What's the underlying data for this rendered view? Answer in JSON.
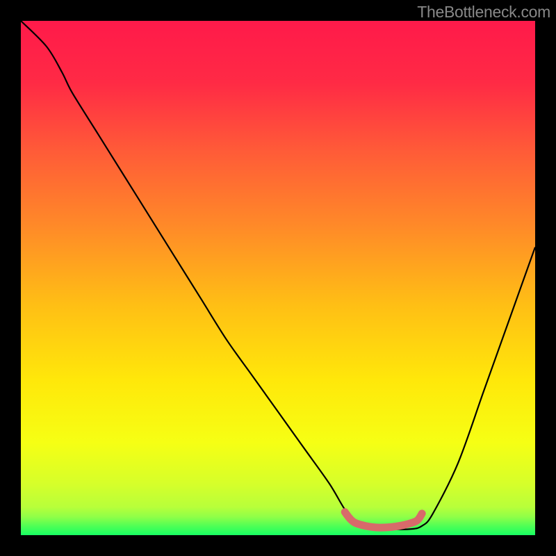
{
  "watermark": "TheBottleneck.com",
  "chart_data": {
    "type": "line",
    "title": "",
    "xlabel": "",
    "ylabel": "",
    "xlim": [
      0,
      100
    ],
    "ylim": [
      0,
      100
    ],
    "series": [
      {
        "name": "curve",
        "x": [
          0,
          5,
          8,
          10,
          15,
          20,
          25,
          30,
          35,
          40,
          45,
          50,
          55,
          60,
          63,
          65,
          68,
          72,
          76,
          78,
          80,
          85,
          90,
          95,
          100
        ],
        "values": [
          100,
          95,
          90,
          86,
          78,
          70,
          62,
          54,
          46,
          38,
          31,
          24,
          17,
          10,
          5,
          3,
          1.8,
          1.2,
          1.2,
          1.8,
          4,
          14,
          28,
          42,
          56
        ]
      },
      {
        "name": "minimum-marker",
        "x": [
          63,
          64,
          65,
          67,
          69,
          71,
          73,
          75,
          77,
          78
        ],
        "values": [
          4.5,
          3.2,
          2.4,
          1.8,
          1.5,
          1.5,
          1.7,
          2.1,
          2.8,
          4.2
        ]
      }
    ],
    "gradient_stops": [
      {
        "offset": 0.0,
        "color": "#ff1a4a"
      },
      {
        "offset": 0.12,
        "color": "#ff2a45"
      },
      {
        "offset": 0.25,
        "color": "#ff5a38"
      },
      {
        "offset": 0.4,
        "color": "#ff8a28"
      },
      {
        "offset": 0.55,
        "color": "#ffbe15"
      },
      {
        "offset": 0.7,
        "color": "#ffe80a"
      },
      {
        "offset": 0.82,
        "color": "#f6ff14"
      },
      {
        "offset": 0.9,
        "color": "#d6ff2a"
      },
      {
        "offset": 0.945,
        "color": "#b8ff3a"
      },
      {
        "offset": 0.965,
        "color": "#8eff48"
      },
      {
        "offset": 0.982,
        "color": "#50ff55"
      },
      {
        "offset": 1.0,
        "color": "#18ff62"
      }
    ],
    "curve_color": "#000000",
    "marker_color": "#d86a6a"
  }
}
